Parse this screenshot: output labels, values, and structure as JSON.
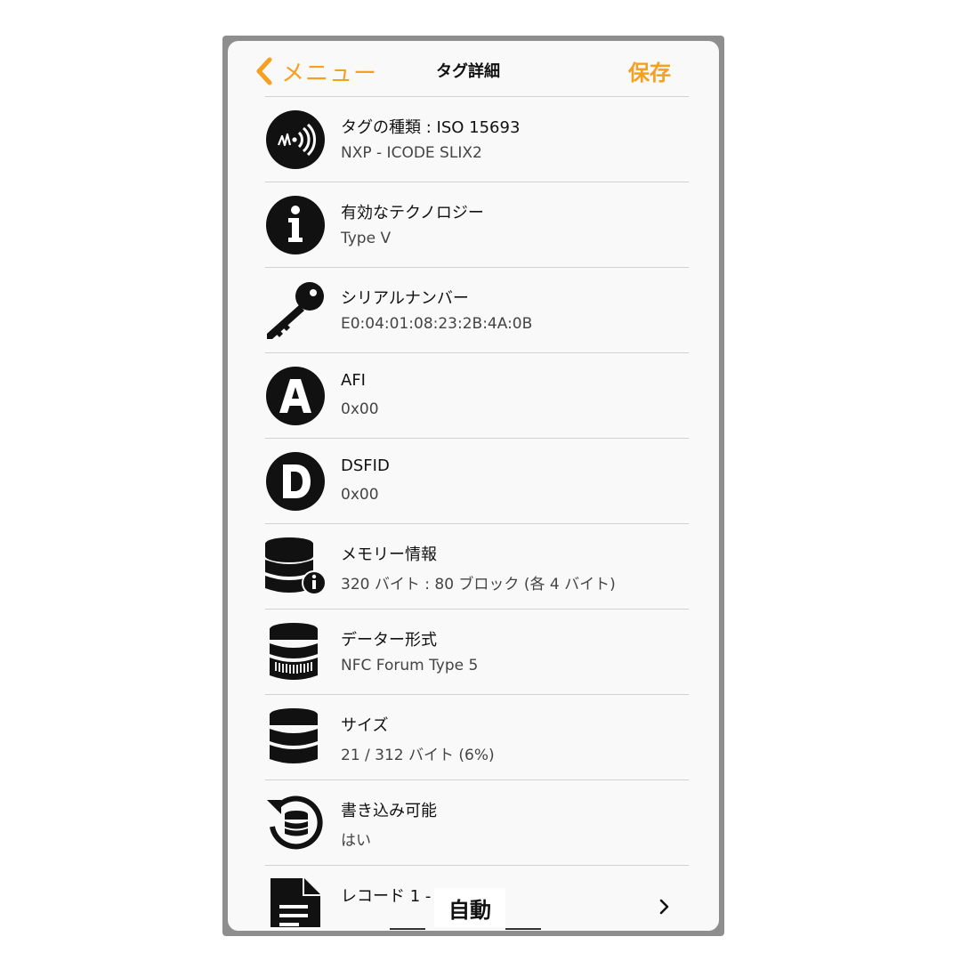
{
  "nav": {
    "back_label": "メニュー",
    "title": "タグ詳細",
    "save_label": "保存"
  },
  "rows": [
    {
      "icon": "nfc-signal-icon",
      "title": "タグの種類 : ISO 15693",
      "value": "NXP - ICODE SLIX2"
    },
    {
      "icon": "info-icon",
      "title": "有効なテクノロジー",
      "value": "Type V"
    },
    {
      "icon": "key-icon",
      "title": "シリアルナンバー",
      "value": "E0:04:01:08:23:2B:4A:0B"
    },
    {
      "icon": "letter-a-icon",
      "title": "AFI",
      "value": "0x00"
    },
    {
      "icon": "letter-d-icon",
      "title": "DSFID",
      "value": "0x00"
    },
    {
      "icon": "database-info-icon",
      "title": "メモリー情報",
      "value": "320 バイト : 80 ブロック (各 4 バイト)"
    },
    {
      "icon": "database-format-icon",
      "title": "データー形式",
      "value": "NFC Forum Type 5"
    },
    {
      "icon": "database-icon",
      "title": "サイズ",
      "value": "21 / 312 バイト (6%)"
    },
    {
      "icon": "database-refresh-icon",
      "title": "書き込み可能",
      "value": "はい"
    },
    {
      "icon": "document-icon",
      "title": "レコード 1 - T",
      "value": ""
    }
  ],
  "overlay": {
    "auto_label": "自動"
  },
  "colors": {
    "accent": "#f5a020",
    "icon": "#111111",
    "divider": "#d2d2d2",
    "background": "#f9f9f9"
  }
}
